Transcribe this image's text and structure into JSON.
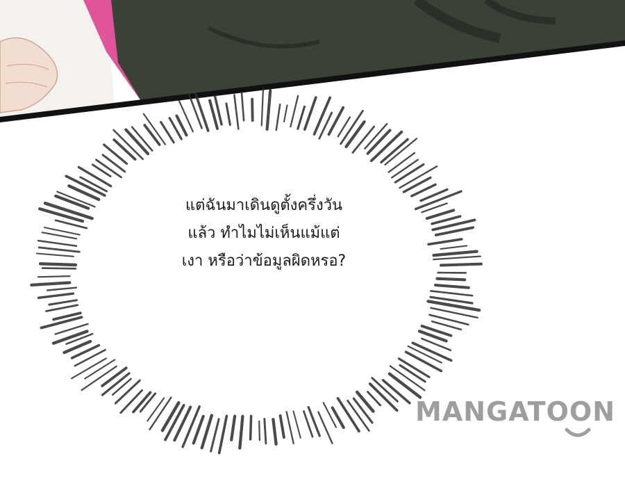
{
  "panel": {
    "speech_lines": [
      "แต่ฉันมาเดินดูตั้งครึ่งวัน",
      "แล้ว ทำไมไม่เห็นแม้แต่",
      "เงา หรือว่าข้อมูลผิดหรอ?"
    ]
  },
  "watermark": {
    "text": "MANGATOON"
  },
  "colors": {
    "background": "#ffffff",
    "burst_lines": "#2b2b2b",
    "jacket": "#3a4137",
    "pink_panel": "#e0559a",
    "skin": "#f3ddd0",
    "watermark": "#9e9e9e"
  }
}
